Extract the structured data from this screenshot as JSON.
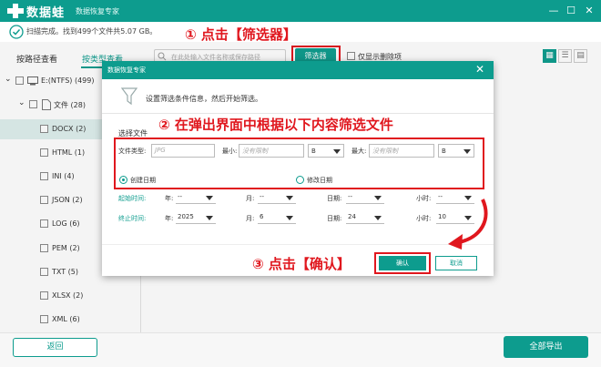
{
  "app": {
    "name": "数据蛙",
    "subtitle": "数据恢复专家"
  },
  "window_controls": {
    "min": "—",
    "max": "☐",
    "close": "✕"
  },
  "status": {
    "text": "扫描完成。找到499个文件共5.07 GB。"
  },
  "sidebar": {
    "tab_path": "按路径查看",
    "tab_type": "按类型查看",
    "drive": "E:(NTFS) (499)",
    "folder": "文件 (28)",
    "items": [
      {
        "label": "DOCX (2)"
      },
      {
        "label": "HTML (1)"
      },
      {
        "label": "INI (4)"
      },
      {
        "label": "JSON (2)"
      },
      {
        "label": "LOG (6)"
      },
      {
        "label": "PEM (2)"
      },
      {
        "label": "TXT (5)"
      },
      {
        "label": "XLSX (2)"
      },
      {
        "label": "XML (6)"
      }
    ]
  },
  "toolbar": {
    "search_placeholder": "在此处输入文件名称或保存路径",
    "filter_label": "筛选器",
    "show_deleted": "仅显示删除项"
  },
  "dialog": {
    "title": "数据恢复专家",
    "description": "设置筛选条件信息，然后开始筛选。",
    "section": "选择文件",
    "file_type_label": "文件类型:",
    "file_type_placeholder": "JPG",
    "min_label": "最小:",
    "min_placeholder": "没有限制",
    "min_unit": "B",
    "max_label": "最大:",
    "max_placeholder": "没有限制",
    "max_unit": "B",
    "created_date": "创建日期",
    "modified_date": "修改日期",
    "start_label": "起始时间:",
    "end_label": "终止时间:",
    "year_label": "年:",
    "month_label": "月:",
    "day_label": "日期:",
    "hour_label": "小时:",
    "start": {
      "year": "--",
      "month": "--",
      "day": "--",
      "hour": "--"
    },
    "end": {
      "year": "2025",
      "month": "6",
      "day": "24",
      "hour": "10"
    },
    "ok": "确认",
    "cancel": "取消"
  },
  "annotations": {
    "step1": "① 点击【筛选器】",
    "step2": "② 在弹出界面中根据以下内容筛选文件",
    "step3": "③ 点击【确认】"
  },
  "bottom": {
    "back": "返回",
    "export_all": "全部导出"
  },
  "colors": {
    "accent": "#0d9c8e",
    "annotation": "#e0171e"
  }
}
